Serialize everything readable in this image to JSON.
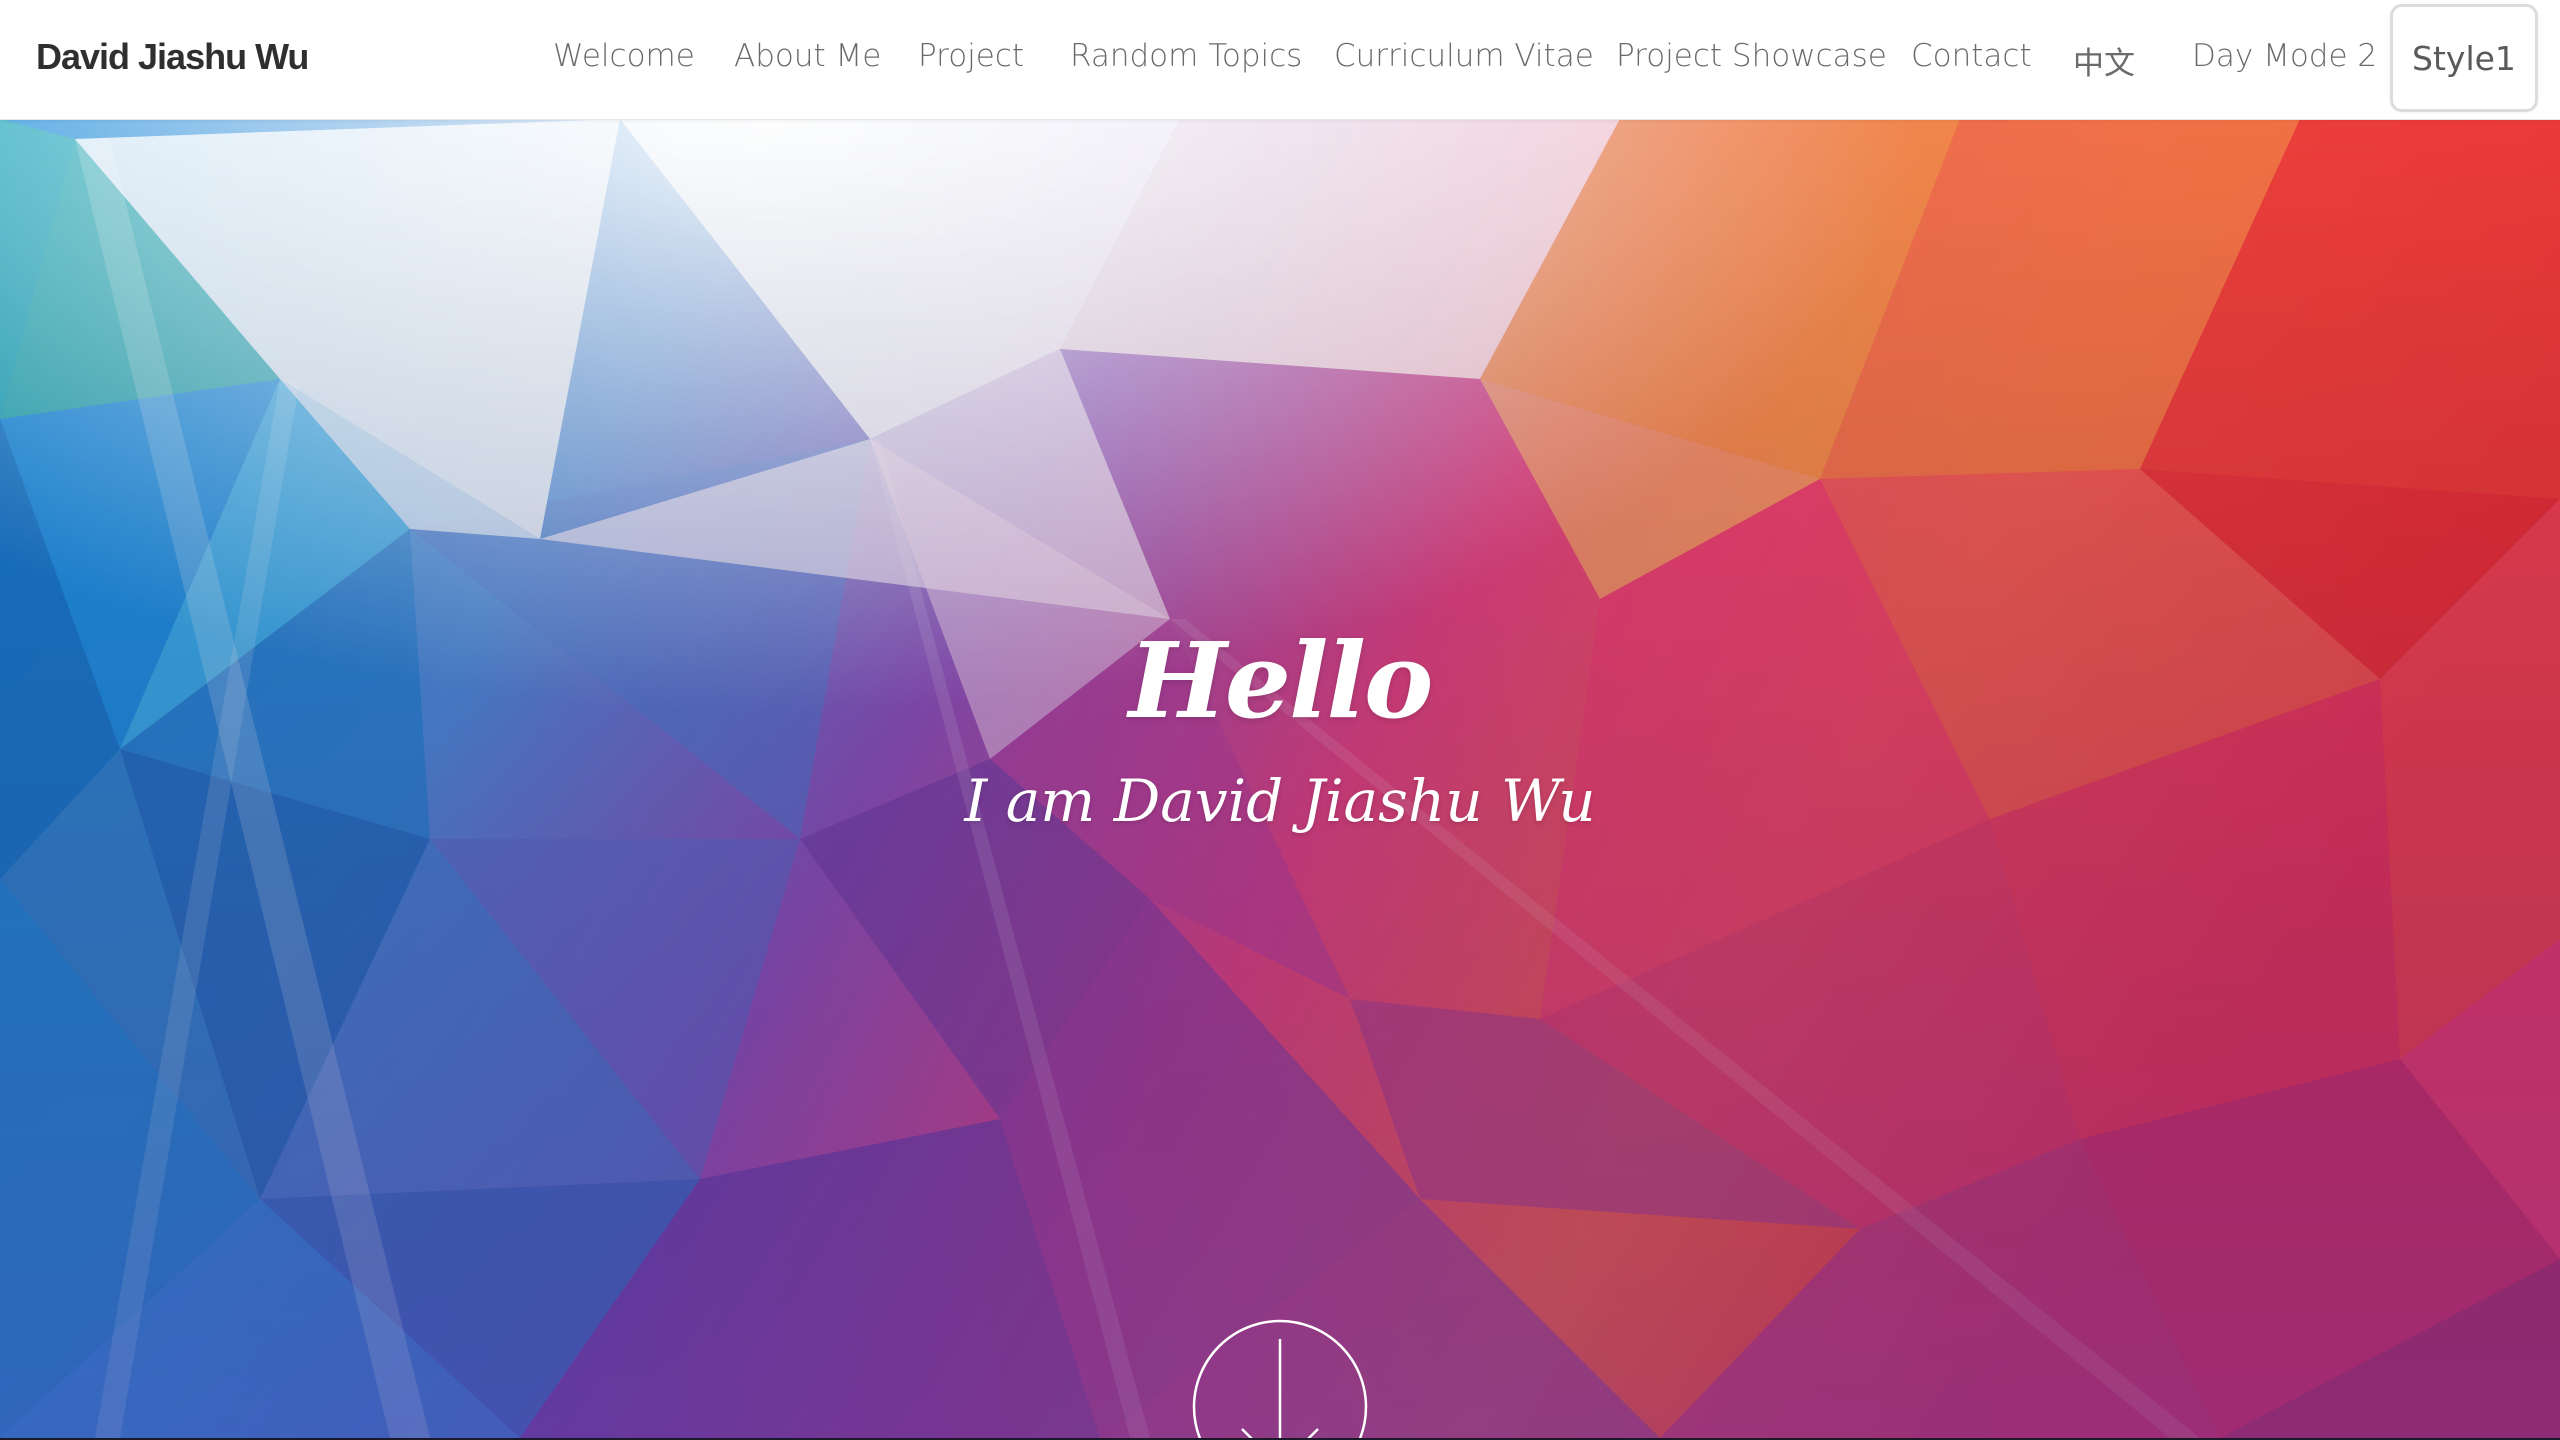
{
  "brand": {
    "name": "David Jiashu Wu"
  },
  "nav": {
    "items": [
      {
        "label": "Welcome"
      },
      {
        "label": "About Me"
      },
      {
        "label": "Project"
      },
      {
        "label": "Random Topics"
      },
      {
        "label": "Curriculum Vitae"
      },
      {
        "label": "Project Showcase"
      },
      {
        "label": "Contact"
      },
      {
        "label": "中文"
      },
      {
        "label": "Day Mode 2"
      }
    ],
    "style_button": "Style1"
  },
  "hero": {
    "title": "Hello",
    "subtitle": "I am David Jiashu Wu",
    "scroll_icon": "arrow-down-circle-icon"
  },
  "colors": {
    "nav_text": "#6a6a6a",
    "brand_text": "#2f2f2f",
    "hero_text": "#ffffff",
    "blue": "#1a8fd8",
    "purple": "#6a3aa0",
    "pink": "#e83a7a",
    "orange": "#f07a3a",
    "red": "#e8242a"
  }
}
